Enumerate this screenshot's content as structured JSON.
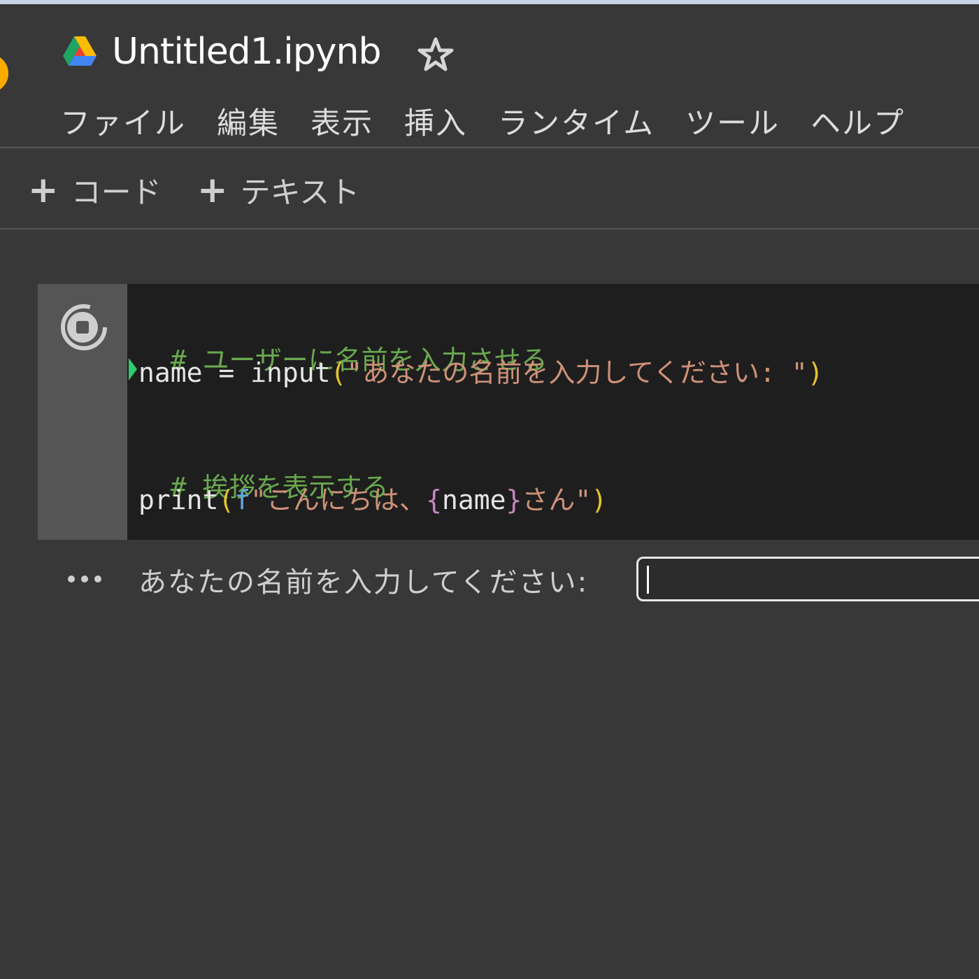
{
  "header": {
    "title": "Untitled1.ipynb",
    "menu": [
      "ファイル",
      "編集",
      "表示",
      "挿入",
      "ランタイム",
      "ツール",
      "ヘルプ"
    ]
  },
  "toolbar": {
    "code_label": "コード",
    "text_label": "テキスト"
  },
  "cell": {
    "lines": [
      {
        "comment": "# ユーザーに名前を入力させる"
      },
      {
        "var": "name",
        "eq": " = ",
        "fn": "input",
        "open": "(",
        "str": "\"あなたの名前を入力してください: \"",
        "close": ")"
      },
      {
        "comment": "# 挨拶を表示する"
      },
      {
        "fn": "print",
        "open": "(",
        "f": "f",
        "str1": "\"こんにちは、",
        "brace_open": "{",
        "inner": "name",
        "brace_close": "}",
        "str2": "さん\"",
        "close": ")"
      }
    ]
  },
  "output": {
    "prompt": "あなたの名前を入力してください:",
    "input_value": ""
  },
  "colors": {
    "background": "#383838",
    "editor": "#1e1e1e",
    "comment": "#6aa84f",
    "string": "#ce9178",
    "paren": "#e6c22e"
  },
  "icons": [
    "colab-logo-icon",
    "drive-icon",
    "star-icon",
    "stop-icon",
    "more-dots-icon"
  ]
}
